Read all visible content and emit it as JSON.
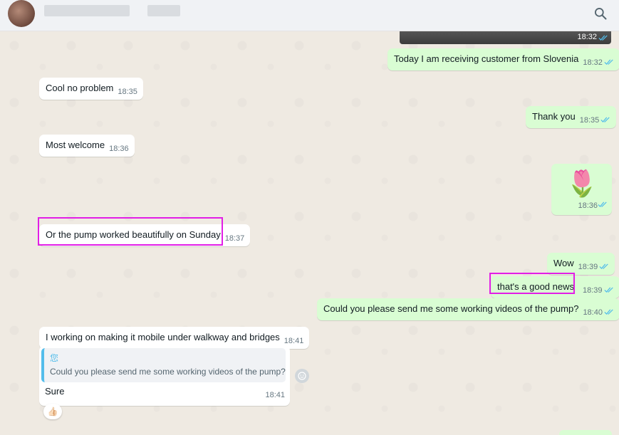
{
  "colors": {
    "incoming": "#ffffff",
    "outgoing": "#d9fdd3",
    "highlight": "#e21ee6",
    "ticks": "#53bdeb"
  },
  "header": {
    "search_icon": "search-icon"
  },
  "messages": {
    "m0_time": "18:32",
    "m1_text": "Today I am receiving customer from Slovenia",
    "m1_time": "18:32",
    "m2_text": "Cool no problem",
    "m2_time": "18:35",
    "m3_text": "Thank you",
    "m3_time": "18:35",
    "m4_text": "Most welcome",
    "m4_time": "18:36",
    "m5_emoji": "🌷",
    "m5_time": "18:36",
    "m6_text": "Or the pump worked beautifully on Sunday",
    "m6_time": "18:37",
    "m7_text": "Wow",
    "m7_time": "18:39",
    "m8_text": "that's a good news",
    "m8_time": "18:39",
    "m9_text": "Could you please send me some working videos of the pump?",
    "m9_time": "18:40",
    "m10_text": "I working on making it mobile under walkway and bridges",
    "m10_time": "18:41",
    "m11_quote_author": "您",
    "m11_quote_text": "Could you please send me some working videos of the pump?",
    "m11_text": "Sure",
    "m11_time": "18:41",
    "reaction": "👍🏻"
  }
}
